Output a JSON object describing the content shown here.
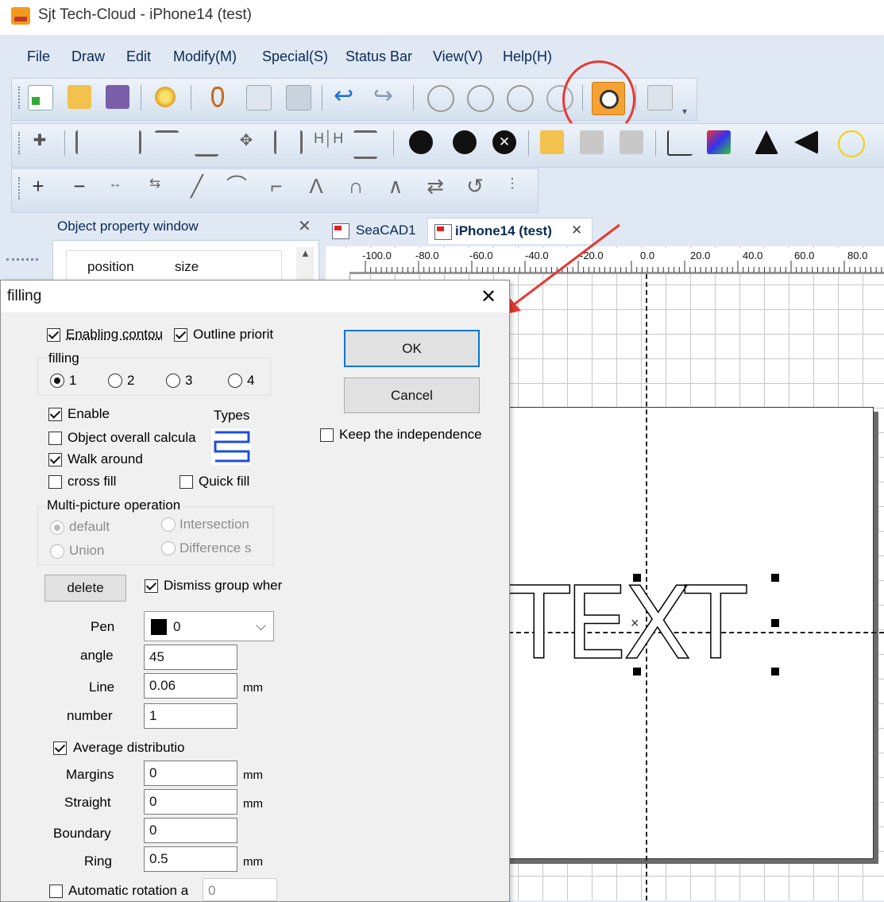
{
  "window": {
    "title": "Sjt Tech-Cloud - iPhone14 (test)"
  },
  "menu": [
    "File",
    "Draw",
    "Edit",
    "Modify(M)",
    "Special(S)",
    "Status Bar",
    "View(V)",
    "Help(H)"
  ],
  "property_panel": {
    "title": "Object property window",
    "col_position": "position",
    "col_size": "size"
  },
  "tabs": [
    {
      "label": "SeaCAD1",
      "active": false
    },
    {
      "label": "iPhone14 (test)",
      "active": true
    }
  ],
  "ruler": {
    "ticks": [
      "-100.0",
      "-80.0",
      "-60.0",
      "-40.0",
      "-20.0",
      "0.0",
      "20.0",
      "40.0",
      "60.0",
      "80.0"
    ]
  },
  "canvas": {
    "text": "TEXT"
  },
  "dialog": {
    "title": "filling",
    "enabling_contour": "Enabling contou",
    "outline_priority": "Outline priorit",
    "filling_group": "filling",
    "fill_options": [
      "1",
      "2",
      "3",
      "4"
    ],
    "enable": "Enable",
    "types": "Types",
    "object_overall": "Object overall calcula",
    "walk_around": "Walk around",
    "cross_fill": "cross fill",
    "quick_fill": "Quick fill",
    "multi_picture": "Multi-picture operation",
    "mp_default": "default",
    "mp_intersection": "Intersection",
    "mp_union": "Union",
    "mp_difference": "Difference s",
    "delete": "delete",
    "dismiss_group": "Dismiss group wher",
    "pen_label": "Pen",
    "pen_value": "0",
    "angle_label": "angle",
    "angle_value": "45",
    "line_label": "Line",
    "line_value": "0.06",
    "number_label": "number",
    "number_value": "1",
    "average_distribution": "Average distributio",
    "margins_label": "Margins",
    "margins_value": "0",
    "straight_label": "Straight",
    "straight_value": "0",
    "boundary_label": "Boundary",
    "boundary_value": "0",
    "ring_label": "Ring",
    "ring_value": "0.5",
    "automatic_rotation": "Automatic rotation a",
    "automatic_rotation_value": "0",
    "unit_mm": "mm",
    "ok": "OK",
    "cancel": "Cancel",
    "keep_independence": "Keep the independence"
  },
  "colors": {
    "accent": "#0078d7",
    "highlight": "#e53935",
    "toolbar_orange": "#f4a233"
  }
}
